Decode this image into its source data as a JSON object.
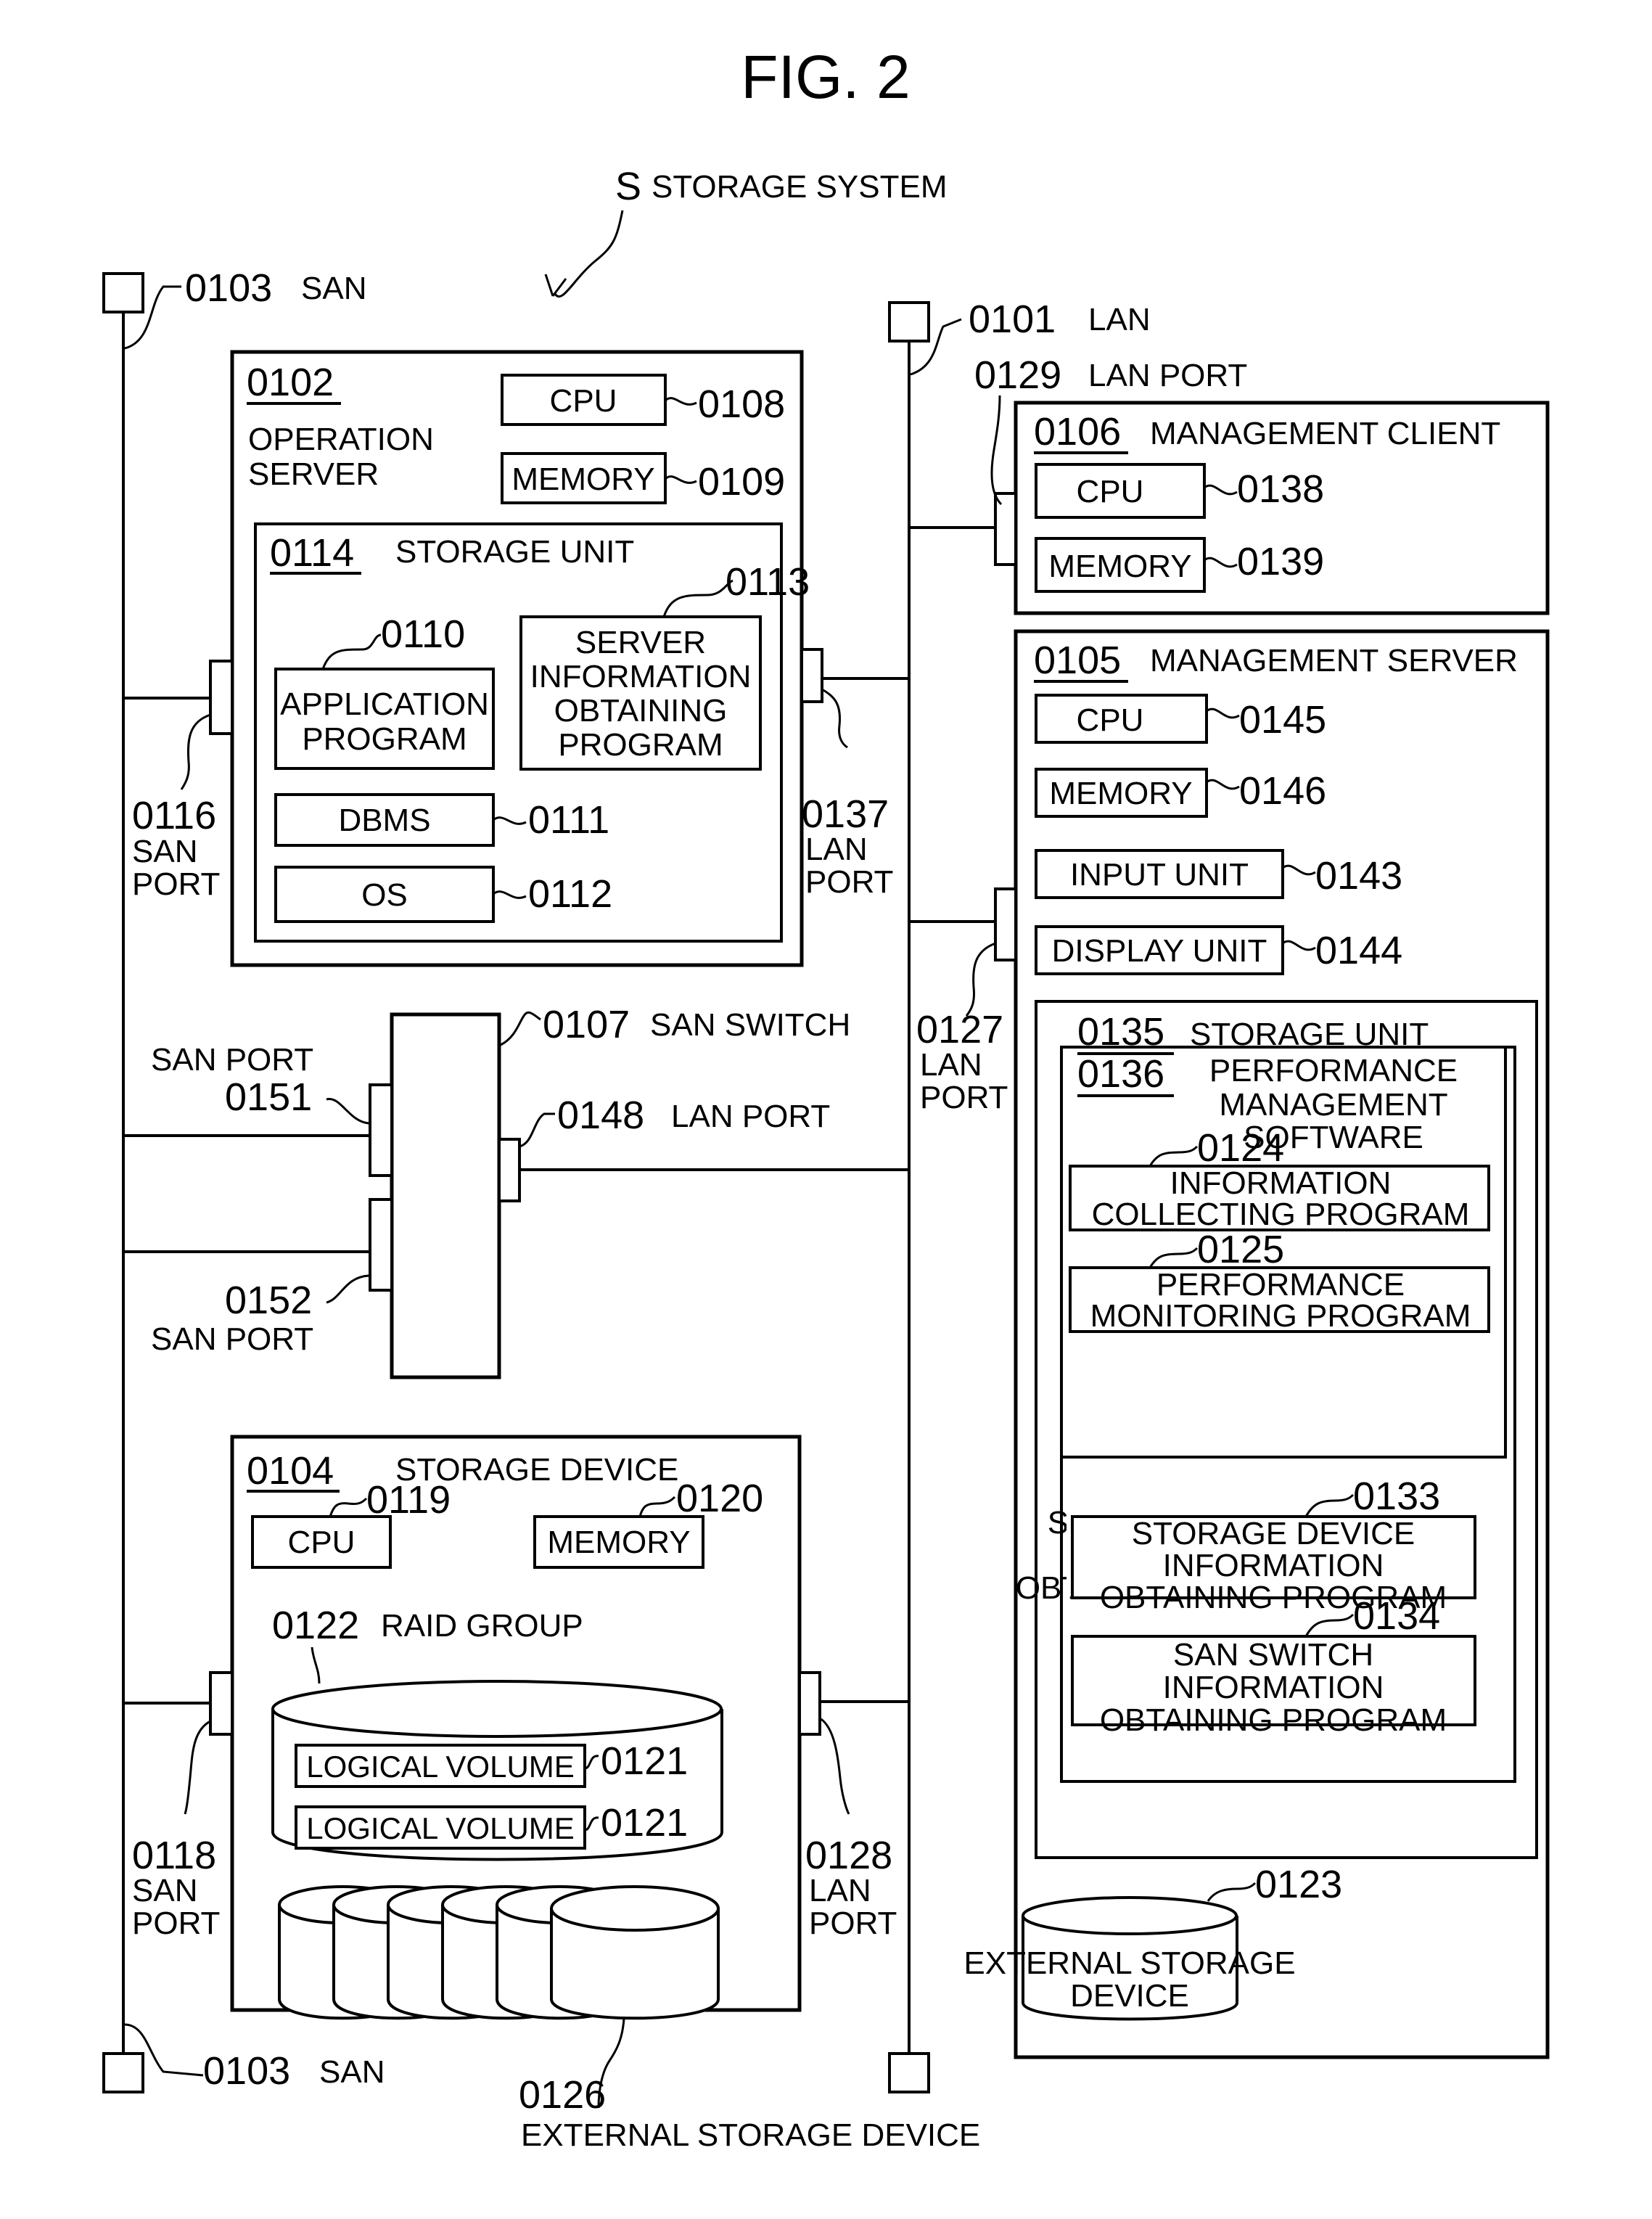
{
  "figure": {
    "title": "FIG. 2",
    "system_ref": "S",
    "system_label": "STORAGE SYSTEM"
  },
  "networks": {
    "san_top": {
      "ref": "0103",
      "label": "SAN"
    },
    "san_bottom": {
      "ref": "0103",
      "label": "SAN"
    },
    "lan": {
      "ref": "0101",
      "label": "LAN"
    }
  },
  "operation_server": {
    "ref": "0102",
    "label_line1": "OPERATION",
    "label_line2": "SERVER",
    "cpu": {
      "label": "CPU",
      "ref": "0108"
    },
    "memory": {
      "label": "MEMORY",
      "ref": "0109"
    },
    "storage_unit": {
      "ref": "0114",
      "label": "STORAGE UNIT",
      "application": {
        "ref": "0110",
        "line1": "APPLICATION",
        "line2": "PROGRAM"
      },
      "server_info": {
        "ref": "0113",
        "line1": "SERVER",
        "line2": "INFORMATION",
        "line3": "OBTAINING",
        "line4": "PROGRAM"
      },
      "dbms": {
        "label": "DBMS",
        "ref": "0111"
      },
      "os": {
        "label": "OS",
        "ref": "0112"
      }
    },
    "san_port": {
      "ref": "0116",
      "line1": "SAN",
      "line2": "PORT"
    },
    "lan_port": {
      "ref": "0137",
      "line1": "LAN",
      "line2": "PORT"
    }
  },
  "san_switch": {
    "ref": "0107",
    "label": "SAN SWITCH",
    "san_port_1": {
      "ref": "0151",
      "label": "SAN PORT"
    },
    "san_port_2": {
      "ref": "0152",
      "label": "SAN PORT"
    },
    "lan_port": {
      "ref": "0148",
      "label": "LAN PORT"
    }
  },
  "storage_device": {
    "ref": "0104",
    "label": "STORAGE DEVICE",
    "cpu": {
      "label": "CPU",
      "ref": "0119"
    },
    "memory": {
      "label": "MEMORY",
      "ref": "0120"
    },
    "raid_group": {
      "ref": "0122",
      "label": "RAID GROUP"
    },
    "logical_volumes": [
      {
        "label": "LOGICAL VOLUME",
        "ref": "0121"
      },
      {
        "label": "LOGICAL VOLUME",
        "ref": "0121"
      }
    ],
    "san_port": {
      "ref": "0118",
      "line1": "SAN",
      "line2": "PORT"
    },
    "lan_port": {
      "ref": "0128",
      "line1": "LAN",
      "line2": "PORT"
    },
    "external_storage": {
      "ref": "0126",
      "label": "EXTERNAL STORAGE DEVICE"
    }
  },
  "management_client": {
    "ref": "0106",
    "label": "MANAGEMENT CLIENT",
    "cpu": {
      "label": "CPU",
      "ref": "0138"
    },
    "memory": {
      "label": "MEMORY",
      "ref": "0139"
    },
    "lan_port": {
      "ref": "0129",
      "label": "LAN PORT"
    }
  },
  "management_server": {
    "ref": "0105",
    "label": "MANAGEMENT SERVER",
    "cpu": {
      "label": "CPU",
      "ref": "0145"
    },
    "memory": {
      "label": "MEMORY",
      "ref": "0146"
    },
    "input_unit": {
      "label": "INPUT UNIT",
      "ref": "0143"
    },
    "display_unit": {
      "label": "DISPLAY UNIT",
      "ref": "0144"
    },
    "lan_port": {
      "ref": "0127",
      "line1": "LAN",
      "line2": "PORT"
    },
    "storage_unit": {
      "ref": "0135",
      "label": "STORAGE UNIT",
      "pm_software": {
        "ref": "0136",
        "line1": "PERFORMANCE",
        "line2": "MANAGEMENT",
        "line3": "SOFTWARE",
        "info_collecting": {
          "ref": "0124",
          "line1": "INFORMATION",
          "line2": "COLLECTING PROGRAM"
        },
        "perf_monitoring": {
          "ref": "0125",
          "line1": "PERFORMANCE",
          "line2": "MONITORING PROGRAM"
        }
      },
      "storage_device_info": {
        "ref": "0133",
        "line1": "STORAGE DEVICE",
        "line2": "INFORMATION",
        "line3": "OBTAINING PROGRAM"
      },
      "san_switch_info": {
        "ref": "0134",
        "line1": "SAN SWITCH",
        "line2": "INFORMATION",
        "line3": "OBTAINING PROGRAM"
      }
    },
    "external_storage": {
      "ref": "0123",
      "line1": "EXTERNAL STORAGE",
      "line2": "DEVICE"
    }
  }
}
